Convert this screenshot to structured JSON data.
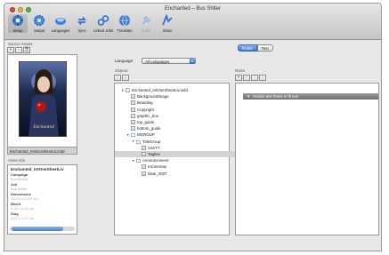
{
  "window": {
    "title": "Enchanted – Bus Shlter"
  },
  "toolbar": {
    "items": [
      {
        "label": "Setup",
        "icon": "setup-icon"
      },
      {
        "label": "Output",
        "icon": "output-gear-icon"
      },
      {
        "label": "Languages",
        "icon": "languages-icon"
      },
      {
        "label": "Sync",
        "icon": "sync-icon"
      },
      {
        "label": "Linked Jobs",
        "icon": "linked-jobs-icon"
      },
      {
        "label": "Translate",
        "icon": "translate-icon"
      },
      {
        "label": "Build",
        "icon": "build-icon"
      },
      {
        "label": "Show",
        "icon": "show-icon"
      }
    ]
  },
  "source_assets": {
    "section_label": "Source Assets",
    "add_label": "+",
    "remove_label": "−",
    "file_label": "🗎",
    "asset_name": "Enchanted_IntOneSheetLiv.indd"
  },
  "asset_info": {
    "section_label": "Asset Info",
    "title": "Enchanted_IntOneSheetLiv",
    "fields": [
      {
        "label": "Campaign",
        "value": "Enchanted"
      },
      {
        "label": "Job",
        "value": "Bus Shlter"
      },
      {
        "label": "Dimensions",
        "value": "102.4 x 63.19 cm"
      },
      {
        "label": "Bleed",
        "value": "0.32 x 0.32 cm"
      },
      {
        "label": "Slug",
        "value": "1.27 x 1.27 cm"
      }
    ]
  },
  "objects": {
    "language_label": "Language:",
    "language_value": "All Languages",
    "section_label": "Objects",
    "up_label": "↑",
    "down_label": "↓",
    "tree": [
      {
        "label": "Enchanted_IntOneSheetLiv.indd",
        "depth": 0,
        "kind": "document",
        "expanded": true
      },
      {
        "label": "BackgroundImage",
        "depth": 1,
        "kind": "frame"
      },
      {
        "label": "Branding",
        "depth": 1,
        "kind": "frame"
      },
      {
        "label": "Copyright",
        "depth": 1,
        "kind": "frame"
      },
      {
        "label": "graphic_box",
        "depth": 1,
        "kind": "frame"
      },
      {
        "label": "top_guide",
        "depth": 1,
        "kind": "frame"
      },
      {
        "label": "bottom_guide",
        "depth": 1,
        "kind": "frame"
      },
      {
        "label": "MGROUP",
        "depth": 1,
        "kind": "group",
        "expanded": true
      },
      {
        "label": "TitleGroup",
        "depth": 2,
        "kind": "group",
        "expanded": true
      },
      {
        "label": "CanTT",
        "depth": 3,
        "kind": "frame"
      },
      {
        "label": "Tagline",
        "depth": 3,
        "kind": "frame",
        "selected": true
      },
      {
        "label": "Announcement",
        "depth": 2,
        "kind": "group",
        "expanded": true
      },
      {
        "label": "InCinemas",
        "depth": 3,
        "kind": "frame"
      },
      {
        "label": "Date_2007",
        "depth": 3,
        "kind": "frame"
      }
    ]
  },
  "rules": {
    "tab_rules": "Rules",
    "tab_text": "Text",
    "section_label": "Rules",
    "add_label": "+",
    "remove_label": "−",
    "up_label": "↑",
    "down_label": "↓",
    "items": [
      {
        "label": "Resize text frame to fit text"
      }
    ]
  }
}
